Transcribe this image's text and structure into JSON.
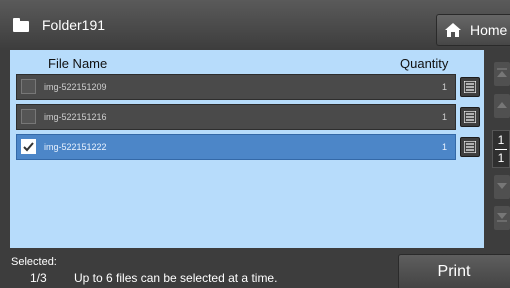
{
  "header": {
    "folder_icon": "folder-icon",
    "folder_name": "Folder191",
    "home_icon": "home-icon",
    "home_label": "Home"
  },
  "table": {
    "columns": {
      "file_name": "File Name",
      "quantity": "Quantity"
    },
    "rows": [
      {
        "name": "img-522151209",
        "quantity": "1",
        "checked": false
      },
      {
        "name": "img-522151216",
        "quantity": "1",
        "checked": false
      },
      {
        "name": "img-522151222",
        "quantity": "1",
        "checked": true
      }
    ],
    "detail_icon": "list-detail-icon"
  },
  "pager": {
    "current": "1",
    "total": "1"
  },
  "footer": {
    "selected_label": "Selected:",
    "selected_count": "1/3",
    "hint": "Up to 6 files can be selected at a time.",
    "print_label": "Print"
  },
  "colors": {
    "panel_bg": "#b7dcfb",
    "row_bg": "#4a4a4a",
    "row_selected_bg": "#4c86c8",
    "chrome_bg": "#3d3d3d"
  }
}
